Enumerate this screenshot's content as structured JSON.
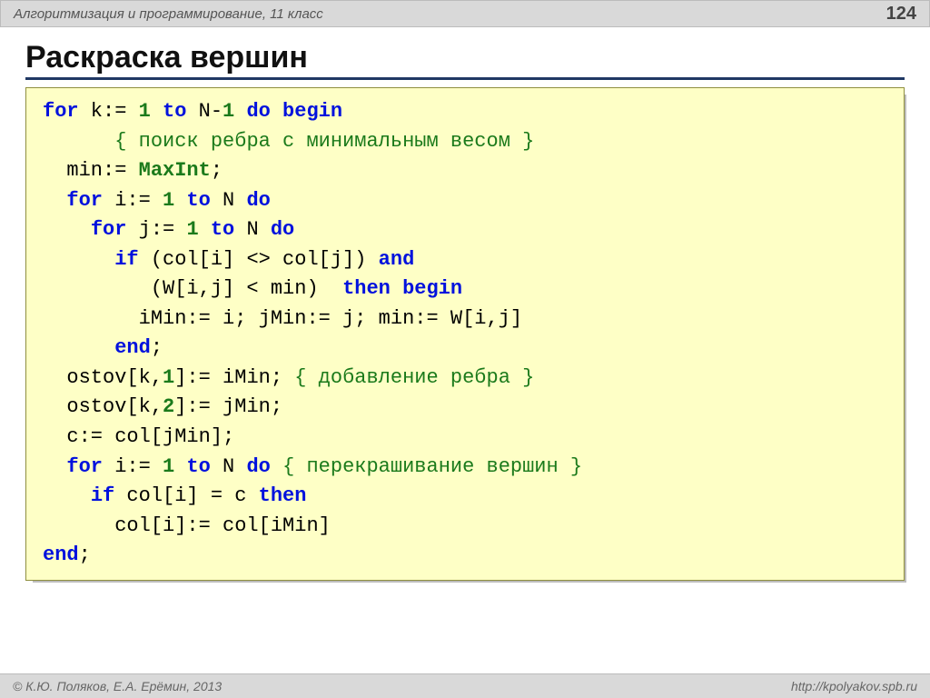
{
  "header": {
    "breadcrumb": "Алгоритмизация и программирование, 11 класс",
    "page_number": "124"
  },
  "title": "Раскраска вершин",
  "code": {
    "l1_a": "for",
    "l1_b": " k:= ",
    "l1_c": "1",
    "l1_d": " ",
    "l1_e": "to",
    "l1_f": " N-",
    "l1_g": "1",
    "l1_h": " ",
    "l1_i": "do begin",
    "l2_a": "{ поиск ребра с минимальным весом }",
    "l3_a": "  min:= ",
    "l3_b": "MaxInt",
    "l3_c": ";",
    "l4_a": "for",
    "l4_b": " i:= ",
    "l4_c": "1",
    "l4_d": " ",
    "l4_e": "to",
    "l4_f": " N ",
    "l4_g": "do",
    "l5_a": "for",
    "l5_b": " j:= ",
    "l5_c": "1",
    "l5_d": " ",
    "l5_e": "to",
    "l5_f": " N ",
    "l5_g": "do",
    "l6_a": "if",
    "l6_b": " (col[i] <> col[j]) ",
    "l6_c": "and",
    "l7_a": "         (W[i,j] < min)  ",
    "l7_b": "then begin",
    "l8_a": "        iMin:= i; jMin:= j; min:= W[i,j]",
    "l9_a": "end",
    "l9_b": ";",
    "l10_a": "  ostov[k,",
    "l10_b": "1",
    "l10_c": "]:= iMin; ",
    "l10_d": "{ добавление ребра }",
    "l11_a": "  ostov[k,",
    "l11_b": "2",
    "l11_c": "]:= jMin;",
    "l12_a": "  c:= col[jMin];",
    "l13_a": "for",
    "l13_b": " i:= ",
    "l13_c": "1",
    "l13_d": " ",
    "l13_e": "to",
    "l13_f": " N ",
    "l13_g": "do",
    "l13_h": " ",
    "l13_i": "{ перекрашивание вершин }",
    "l14_a": "if",
    "l14_b": " col[i] = c ",
    "l14_c": "then",
    "l15_a": "      col[i]:= col[iMin]",
    "l16_a": "end",
    "l16_b": ";"
  },
  "footer": {
    "copyright": "© К.Ю. Поляков, Е.А. Ерёмин, 2013",
    "url": "http://kpolyakov.spb.ru"
  }
}
